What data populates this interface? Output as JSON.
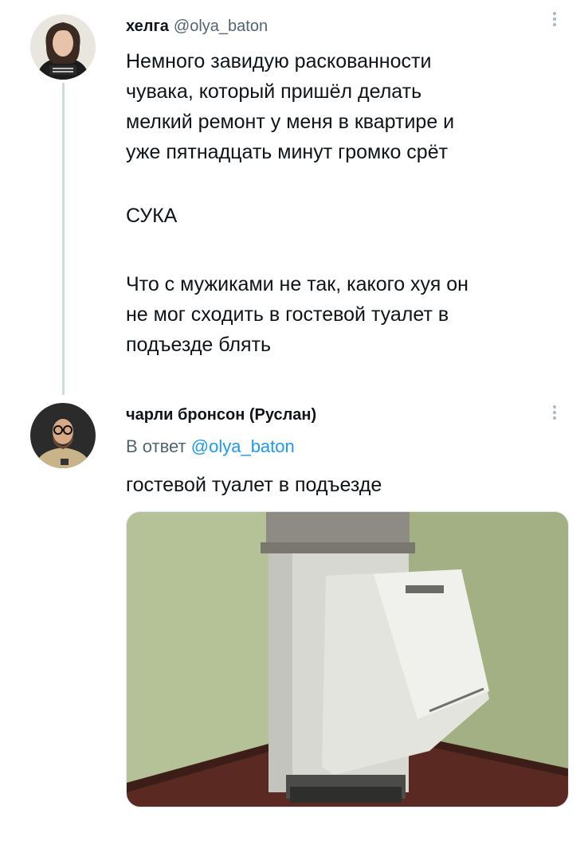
{
  "tweet1": {
    "name": "хелга",
    "handle": "@olya_baton",
    "paragraphs": [
      [
        "Немного завидую раскованности",
        "чувака, который пришёл делать",
        "мелкий ремонт у меня в квартире и",
        "уже пятнадцать минут громко срёт"
      ],
      [
        "СУКА"
      ],
      [
        "Что с мужиками не так, какого хуя он",
        "не мог сходить в гостевой туалет в",
        "подъезде блять"
      ]
    ]
  },
  "tweet2": {
    "name": "чарли бронсон (Руслан)",
    "reply_prefix": "В ответ",
    "reply_mention": "@olya_baton",
    "text": "гостевой туалет в подъезде"
  },
  "colors": {
    "text": "#0f1419",
    "secondary": "#536471",
    "link": "#1d9bf0",
    "thread_line": "#cfd9de"
  },
  "icons": {
    "more": "more-vertical-icon"
  }
}
